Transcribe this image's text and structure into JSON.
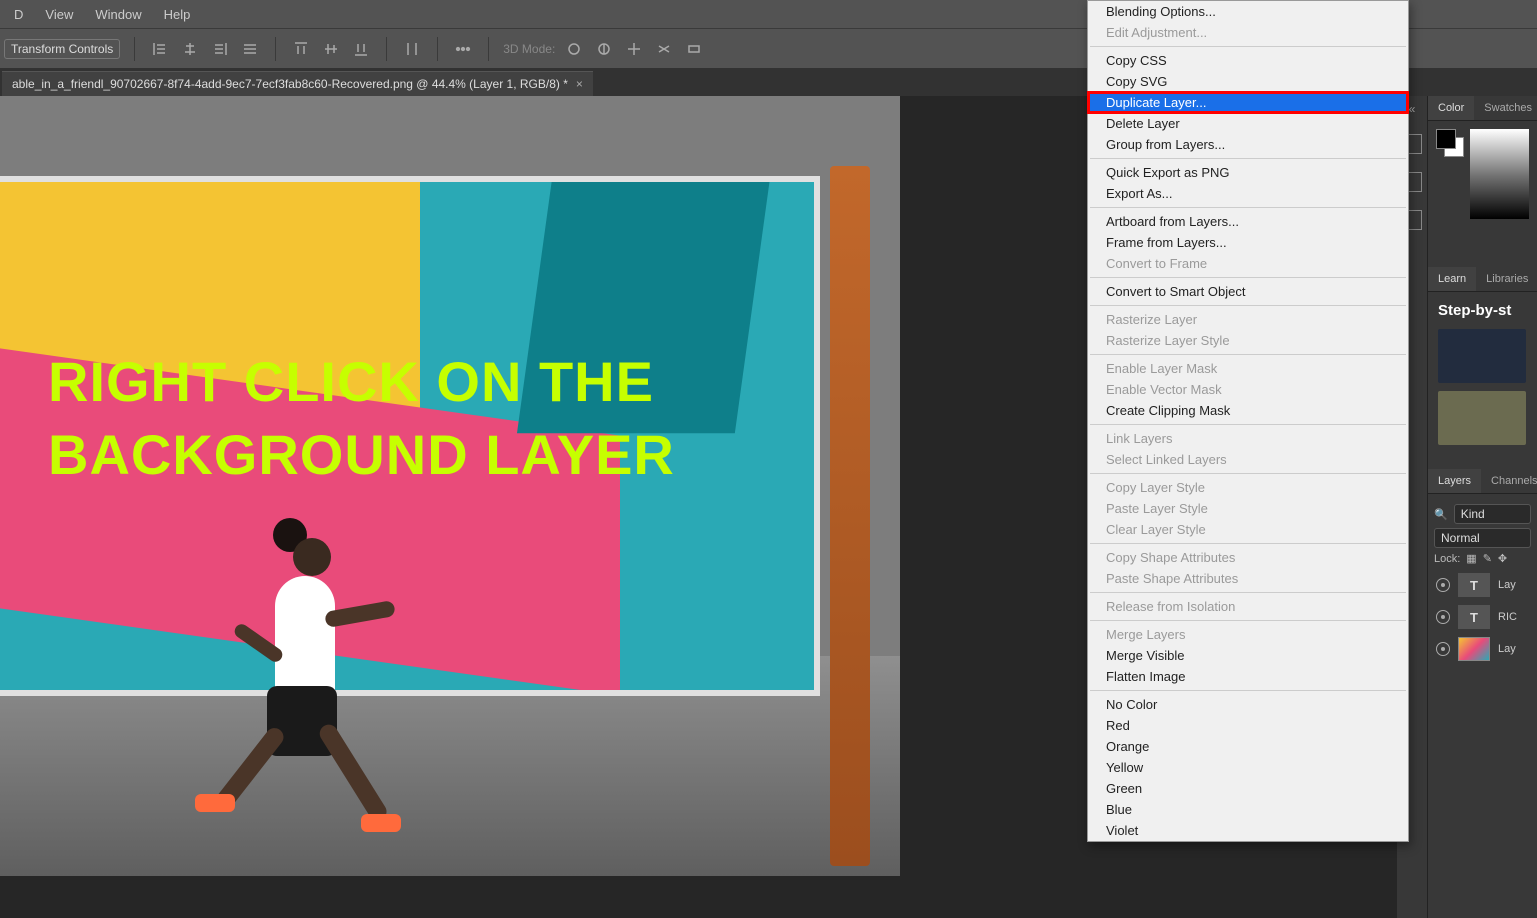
{
  "menu": {
    "items": [
      "D",
      "View",
      "Window",
      "Help"
    ]
  },
  "options_bar": {
    "label": "Transform Controls",
    "mode_label": "3D Mode:"
  },
  "document_tab": {
    "title": "able_in_a_friendl_90702667-8f74-4add-9ec7-7ecf3fab8c60-Recovered.png @ 44.4% (Layer 1, RGB/8) *",
    "close": "×"
  },
  "canvas": {
    "overlay_line1": "RIGHT CLICK ON THE",
    "overlay_line2": "BACKGROUND LAYER"
  },
  "panels": {
    "color": {
      "tab1": "Color",
      "tab2": "Swatches"
    },
    "learn": {
      "tab1": "Learn",
      "tab2": "Libraries",
      "heading": "Step-by-st"
    },
    "layers": {
      "tab1": "Layers",
      "tab2": "Channels",
      "kind_label": "Kind",
      "blend_mode": "Normal",
      "lock_label": "Lock:",
      "items": [
        {
          "type": "T",
          "name": "Lay"
        },
        {
          "type": "T",
          "name": "RIC"
        },
        {
          "type": "img",
          "name": "Lay"
        }
      ]
    }
  },
  "context_menu": {
    "items": [
      {
        "label": "Blending Options...",
        "enabled": true
      },
      {
        "label": "Edit Adjustment...",
        "enabled": false
      },
      {
        "sep": true
      },
      {
        "label": "Copy CSS",
        "enabled": true
      },
      {
        "label": "Copy SVG",
        "enabled": true
      },
      {
        "label": "Duplicate Layer...",
        "enabled": true,
        "highlight": true
      },
      {
        "label": "Delete Layer",
        "enabled": true
      },
      {
        "label": "Group from Layers...",
        "enabled": true
      },
      {
        "sep": true
      },
      {
        "label": "Quick Export as PNG",
        "enabled": true
      },
      {
        "label": "Export As...",
        "enabled": true
      },
      {
        "sep": true
      },
      {
        "label": "Artboard from Layers...",
        "enabled": true
      },
      {
        "label": "Frame from Layers...",
        "enabled": true
      },
      {
        "label": "Convert to Frame",
        "enabled": false
      },
      {
        "sep": true
      },
      {
        "label": "Convert to Smart Object",
        "enabled": true
      },
      {
        "sep": true
      },
      {
        "label": "Rasterize Layer",
        "enabled": false
      },
      {
        "label": "Rasterize Layer Style",
        "enabled": false
      },
      {
        "sep": true
      },
      {
        "label": "Enable Layer Mask",
        "enabled": false
      },
      {
        "label": "Enable Vector Mask",
        "enabled": false
      },
      {
        "label": "Create Clipping Mask",
        "enabled": true
      },
      {
        "sep": true
      },
      {
        "label": "Link Layers",
        "enabled": false
      },
      {
        "label": "Select Linked Layers",
        "enabled": false
      },
      {
        "sep": true
      },
      {
        "label": "Copy Layer Style",
        "enabled": false
      },
      {
        "label": "Paste Layer Style",
        "enabled": false
      },
      {
        "label": "Clear Layer Style",
        "enabled": false
      },
      {
        "sep": true
      },
      {
        "label": "Copy Shape Attributes",
        "enabled": false
      },
      {
        "label": "Paste Shape Attributes",
        "enabled": false
      },
      {
        "sep": true
      },
      {
        "label": "Release from Isolation",
        "enabled": false
      },
      {
        "sep": true
      },
      {
        "label": "Merge Layers",
        "enabled": false
      },
      {
        "label": "Merge Visible",
        "enabled": true
      },
      {
        "label": "Flatten Image",
        "enabled": true
      },
      {
        "sep": true
      },
      {
        "label": "No Color",
        "enabled": true
      },
      {
        "label": "Red",
        "enabled": true
      },
      {
        "label": "Orange",
        "enabled": true
      },
      {
        "label": "Yellow",
        "enabled": true
      },
      {
        "label": "Green",
        "enabled": true
      },
      {
        "label": "Blue",
        "enabled": true
      },
      {
        "label": "Violet",
        "enabled": true
      }
    ]
  }
}
